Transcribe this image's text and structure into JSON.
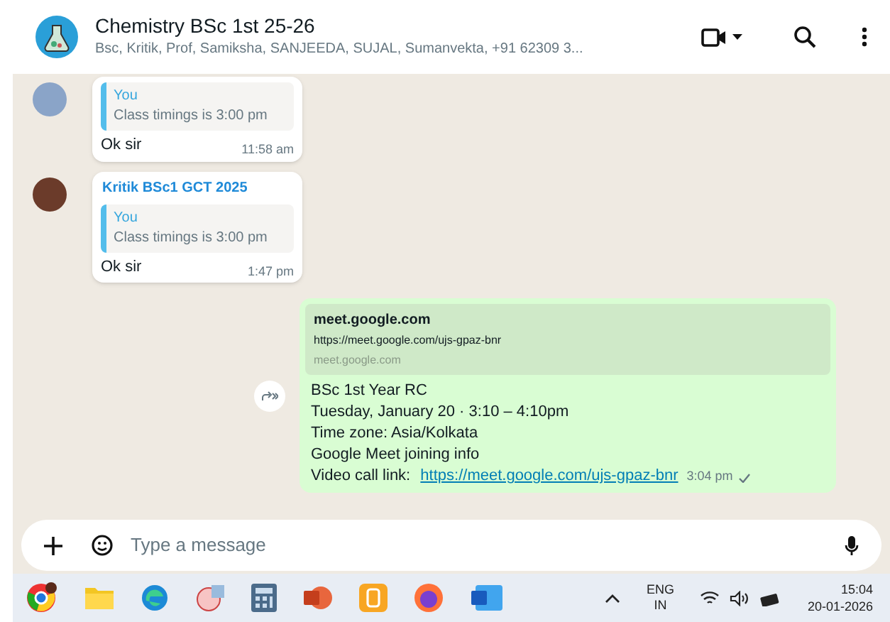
{
  "header": {
    "title": "Chemistry BSc 1st 25-26",
    "subtitle": "Bsc, Kritik, Prof, Samiksha, SANJEEDA, SUJAL, Sumanvekta, +91 62309 3..."
  },
  "messages": [
    {
      "kind": "incoming",
      "quote": {
        "author": "You",
        "text": "Class timings is 3:00 pm"
      },
      "text": "Ok sir",
      "time": "11:58 am"
    },
    {
      "kind": "incoming",
      "sender": "Kritik BSc1 GCT 2025",
      "quote": {
        "author": "You",
        "text": "Class timings is 3:00 pm"
      },
      "text": "Ok sir",
      "time": "1:47 pm"
    },
    {
      "kind": "outgoing",
      "preview": {
        "title": "meet.google.com",
        "url": "https://meet.google.com/ujs-gpaz-bnr",
        "domain": "meet.google.com"
      },
      "lines": [
        "BSc 1st Year RC",
        "Tuesday, January 20 · 3:10 – 4:10pm",
        "Time zone: Asia/Kolkata",
        "Google Meet joining info"
      ],
      "link_label": "Video call link: ",
      "link": "https://meet.google.com/ujs-gpaz-bnr",
      "time": "3:04 pm"
    }
  ],
  "composer": {
    "placeholder": "Type a message"
  },
  "taskbar": {
    "language": "ENG",
    "region": "IN",
    "time": "15:04",
    "date": "20-01-2026"
  }
}
